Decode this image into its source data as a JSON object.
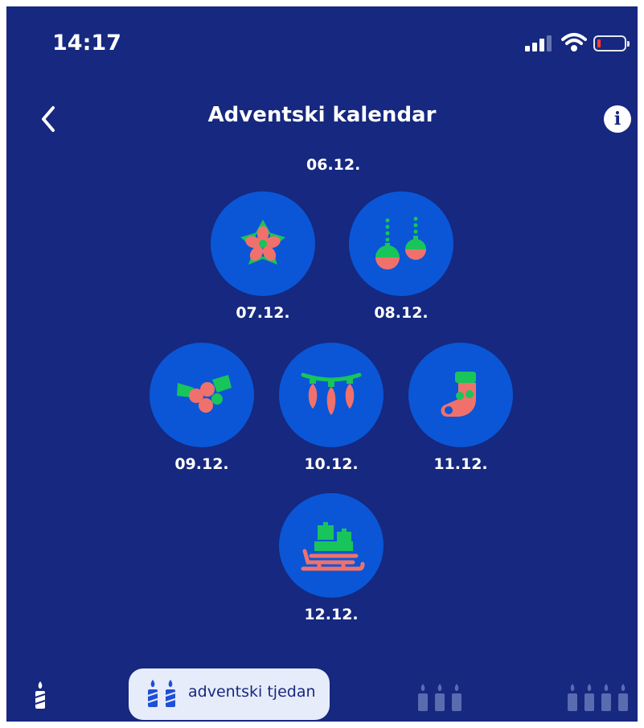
{
  "status_bar": {
    "time": "14:17"
  },
  "header": {
    "title": "Adventski kalendar",
    "info_glyph": "i"
  },
  "calendar": {
    "top_label": "06.12.",
    "days": [
      {
        "date": "07.12.",
        "icon": "poinsettia-icon"
      },
      {
        "date": "08.12.",
        "icon": "ornaments-icon"
      },
      {
        "date": "09.12.",
        "icon": "holly-icon"
      },
      {
        "date": "10.12.",
        "icon": "string-lights-icon"
      },
      {
        "date": "11.12.",
        "icon": "stocking-icon"
      },
      {
        "date": "12.12.",
        "icon": "sleigh-gifts-icon"
      }
    ]
  },
  "bottom_tabs": {
    "active_label": "adventski tjedan",
    "tabs": [
      "one-candle",
      "two-candles",
      "three-candles",
      "four-candles"
    ]
  },
  "colors": {
    "background": "#16287f",
    "circle": "#0a56d6",
    "green": "#19c45a",
    "coral": "#f0716c",
    "pill": "#e7ecfa"
  }
}
